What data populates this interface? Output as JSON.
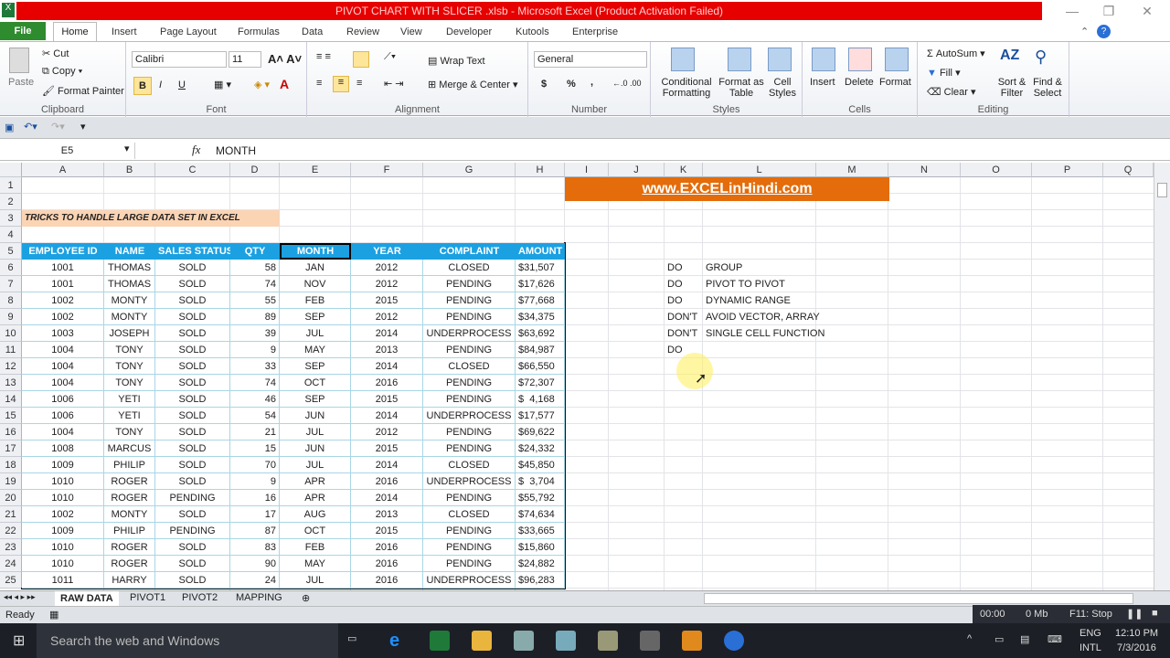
{
  "window": {
    "title": "PIVOT CHART WITH SLICER .xlsb  -  Microsoft Excel (Product Activation Failed)",
    "min": "—",
    "restore": "❐",
    "close": "✕"
  },
  "tabs": [
    "File",
    "Home",
    "Insert",
    "Page Layout",
    "Formulas",
    "Data",
    "Review",
    "View",
    "Developer",
    "Kutools",
    "Enterprise"
  ],
  "ribbon": {
    "clipboard": {
      "paste": "Paste",
      "cut": "Cut",
      "copy": "Copy",
      "painter": "Format Painter",
      "label": "Clipboard"
    },
    "font": {
      "name": "Calibri",
      "size": "11",
      "bold": "B",
      "italic": "I",
      "underline": "U",
      "label": "Font"
    },
    "alignment": {
      "wrap": "Wrap Text",
      "merge": "Merge & Center",
      "label": "Alignment"
    },
    "number": {
      "format": "General",
      "currency": "$",
      "percent": "%",
      "comma": ",",
      "label": "Number"
    },
    "styles": {
      "cond": "Conditional Formatting",
      "table": "Format as Table",
      "cell": "Cell Styles",
      "label": "Styles"
    },
    "cells": {
      "insert": "Insert",
      "delete": "Delete",
      "format": "Format",
      "label": "Cells"
    },
    "editing": {
      "autosum": "AutoSum",
      "fill": "Fill",
      "clear": "Clear",
      "sort": "Sort & Filter",
      "find": "Find & Select",
      "label": "Editing"
    }
  },
  "formula_bar": {
    "name_box": "E5",
    "fx": "fx",
    "value": "MONTH"
  },
  "columns": [
    "A",
    "B",
    "C",
    "D",
    "E",
    "F",
    "G",
    "H",
    "I",
    "J",
    "K",
    "L",
    "M",
    "N",
    "O",
    "P",
    "Q"
  ],
  "sheet": {
    "banner": "www.EXCELinHindi.com",
    "subtitle": "TRICKS TO HANDLE LARGE DATA SET IN EXCEL",
    "headers": [
      "EMPLOYEE ID",
      "NAME",
      "SALES STATUS",
      "QTY",
      "MONTH",
      "YEAR",
      "COMPLAINT",
      "AMOUNT"
    ],
    "rows": [
      [
        "1001",
        "THOMAS",
        "SOLD",
        "58",
        "JAN",
        "2012",
        "CLOSED",
        "$31,507"
      ],
      [
        "1001",
        "THOMAS",
        "SOLD",
        "74",
        "NOV",
        "2012",
        "PENDING",
        "$17,626"
      ],
      [
        "1002",
        "MONTY",
        "SOLD",
        "55",
        "FEB",
        "2015",
        "PENDING",
        "$77,668"
      ],
      [
        "1002",
        "MONTY",
        "SOLD",
        "89",
        "SEP",
        "2012",
        "PENDING",
        "$34,375"
      ],
      [
        "1003",
        "JOSEPH",
        "SOLD",
        "39",
        "JUL",
        "2014",
        "UNDERPROCESS",
        "$63,692"
      ],
      [
        "1004",
        "TONY",
        "SOLD",
        "9",
        "MAY",
        "2013",
        "PENDING",
        "$84,987"
      ],
      [
        "1004",
        "TONY",
        "SOLD",
        "33",
        "SEP",
        "2014",
        "CLOSED",
        "$66,550"
      ],
      [
        "1004",
        "TONY",
        "SOLD",
        "74",
        "OCT",
        "2016",
        "PENDING",
        "$72,307"
      ],
      [
        "1006",
        "YETI",
        "SOLD",
        "46",
        "SEP",
        "2015",
        "PENDING",
        "$  4,168"
      ],
      [
        "1006",
        "YETI",
        "SOLD",
        "54",
        "JUN",
        "2014",
        "UNDERPROCESS",
        "$17,577"
      ],
      [
        "1004",
        "TONY",
        "SOLD",
        "21",
        "JUL",
        "2012",
        "PENDING",
        "$69,622"
      ],
      [
        "1008",
        "MARCUS",
        "SOLD",
        "15",
        "JUN",
        "2015",
        "PENDING",
        "$24,332"
      ],
      [
        "1009",
        "PHILIP",
        "SOLD",
        "70",
        "JUL",
        "2014",
        "CLOSED",
        "$45,850"
      ],
      [
        "1010",
        "ROGER",
        "SOLD",
        "9",
        "APR",
        "2016",
        "UNDERPROCESS",
        "$  3,704"
      ],
      [
        "1010",
        "ROGER",
        "PENDING",
        "16",
        "APR",
        "2014",
        "PENDING",
        "$55,792"
      ],
      [
        "1002",
        "MONTY",
        "SOLD",
        "17",
        "AUG",
        "2013",
        "CLOSED",
        "$74,634"
      ],
      [
        "1009",
        "PHILIP",
        "PENDING",
        "87",
        "OCT",
        "2015",
        "PENDING",
        "$33,665"
      ],
      [
        "1010",
        "ROGER",
        "SOLD",
        "83",
        "FEB",
        "2016",
        "PENDING",
        "$15,860"
      ],
      [
        "1010",
        "ROGER",
        "SOLD",
        "90",
        "MAY",
        "2016",
        "PENDING",
        "$24,882"
      ],
      [
        "1011",
        "HARRY",
        "SOLD",
        "24",
        "JUL",
        "2016",
        "UNDERPROCESS",
        "$96,283"
      ]
    ],
    "notes": [
      [
        "DO",
        "GROUP"
      ],
      [
        "DO",
        "PIVOT TO PIVOT"
      ],
      [
        "DO",
        "DYNAMIC RANGE"
      ],
      [
        "DON'T",
        "AVOID VECTOR, ARRAY"
      ],
      [
        "DON'T",
        "SINGLE CELL FUNCTION"
      ],
      [
        "DO",
        ""
      ]
    ]
  },
  "sheet_tabs": [
    "RAW DATA",
    "PIVOT1",
    "PIVOT2",
    "MAPPING"
  ],
  "status": {
    "ready": "Ready",
    "timer": "00:00",
    "mem": "0 Mb",
    "stop": "F11: Stop"
  },
  "taskbar": {
    "search": "Search the web and Windows",
    "lang1": "ENG",
    "lang2": "INTL",
    "time": "12:10 PM",
    "date": "7/3/2016"
  },
  "colors": {
    "title": "#e60000",
    "header": "#1ba1e2",
    "banner": "#e46c0a",
    "subtitle_bg": "#fbd4b4"
  }
}
